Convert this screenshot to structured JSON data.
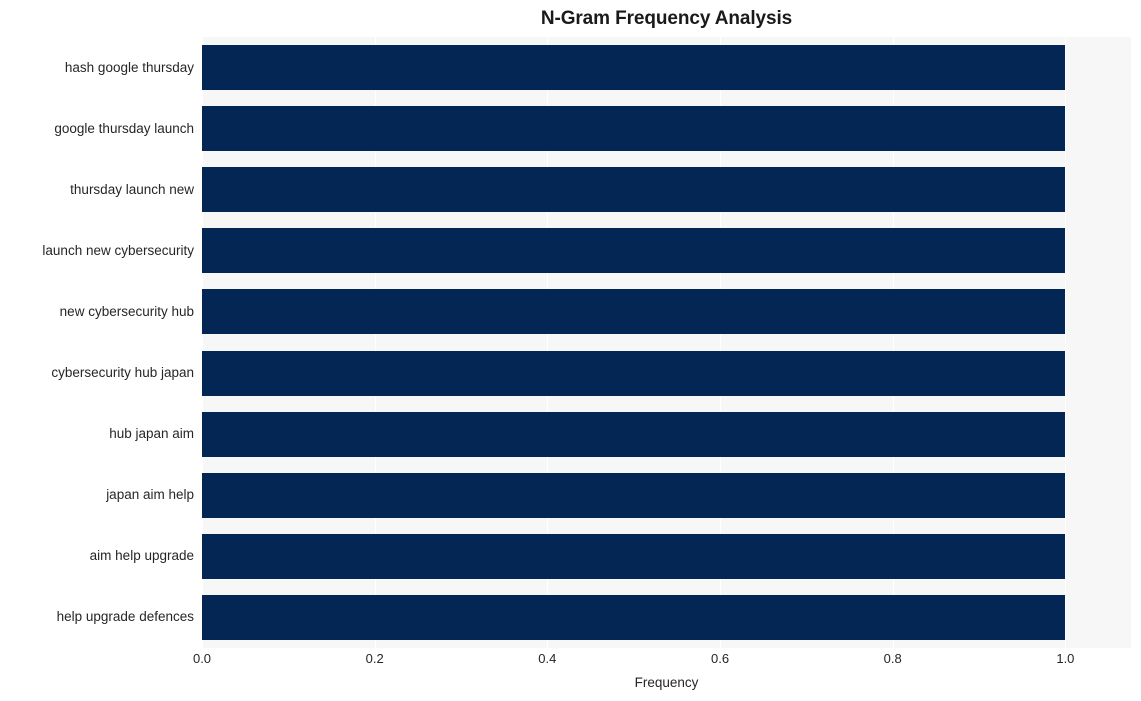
{
  "chart_data": {
    "type": "bar",
    "orientation": "horizontal",
    "title": "N-Gram Frequency Analysis",
    "xlabel": "Frequency",
    "ylabel": "",
    "categories": [
      "hash google thursday",
      "google thursday launch",
      "thursday launch new",
      "launch new cybersecurity",
      "new cybersecurity hub",
      "cybersecurity hub japan",
      "hub japan aim",
      "japan aim help",
      "aim help upgrade",
      "help upgrade defences"
    ],
    "values": [
      1.0,
      1.0,
      1.0,
      1.0,
      1.0,
      1.0,
      1.0,
      1.0,
      1.0,
      1.0
    ],
    "xlim": [
      0.0,
      1.076
    ],
    "xticks": [
      0.0,
      0.2,
      0.4,
      0.6,
      0.8,
      1.0
    ],
    "xtick_labels": [
      "0.0",
      "0.2",
      "0.4",
      "0.6",
      "0.8",
      "1.0"
    ],
    "grid": true,
    "grid_axis": "x",
    "legend": null,
    "bar_color": "#042654",
    "plot_background": "#f7f7f7",
    "figure_background": "#ffffff",
    "gridline_color": "#ffffff",
    "text_color": "#262626",
    "title_color": "#1a1a1a"
  }
}
